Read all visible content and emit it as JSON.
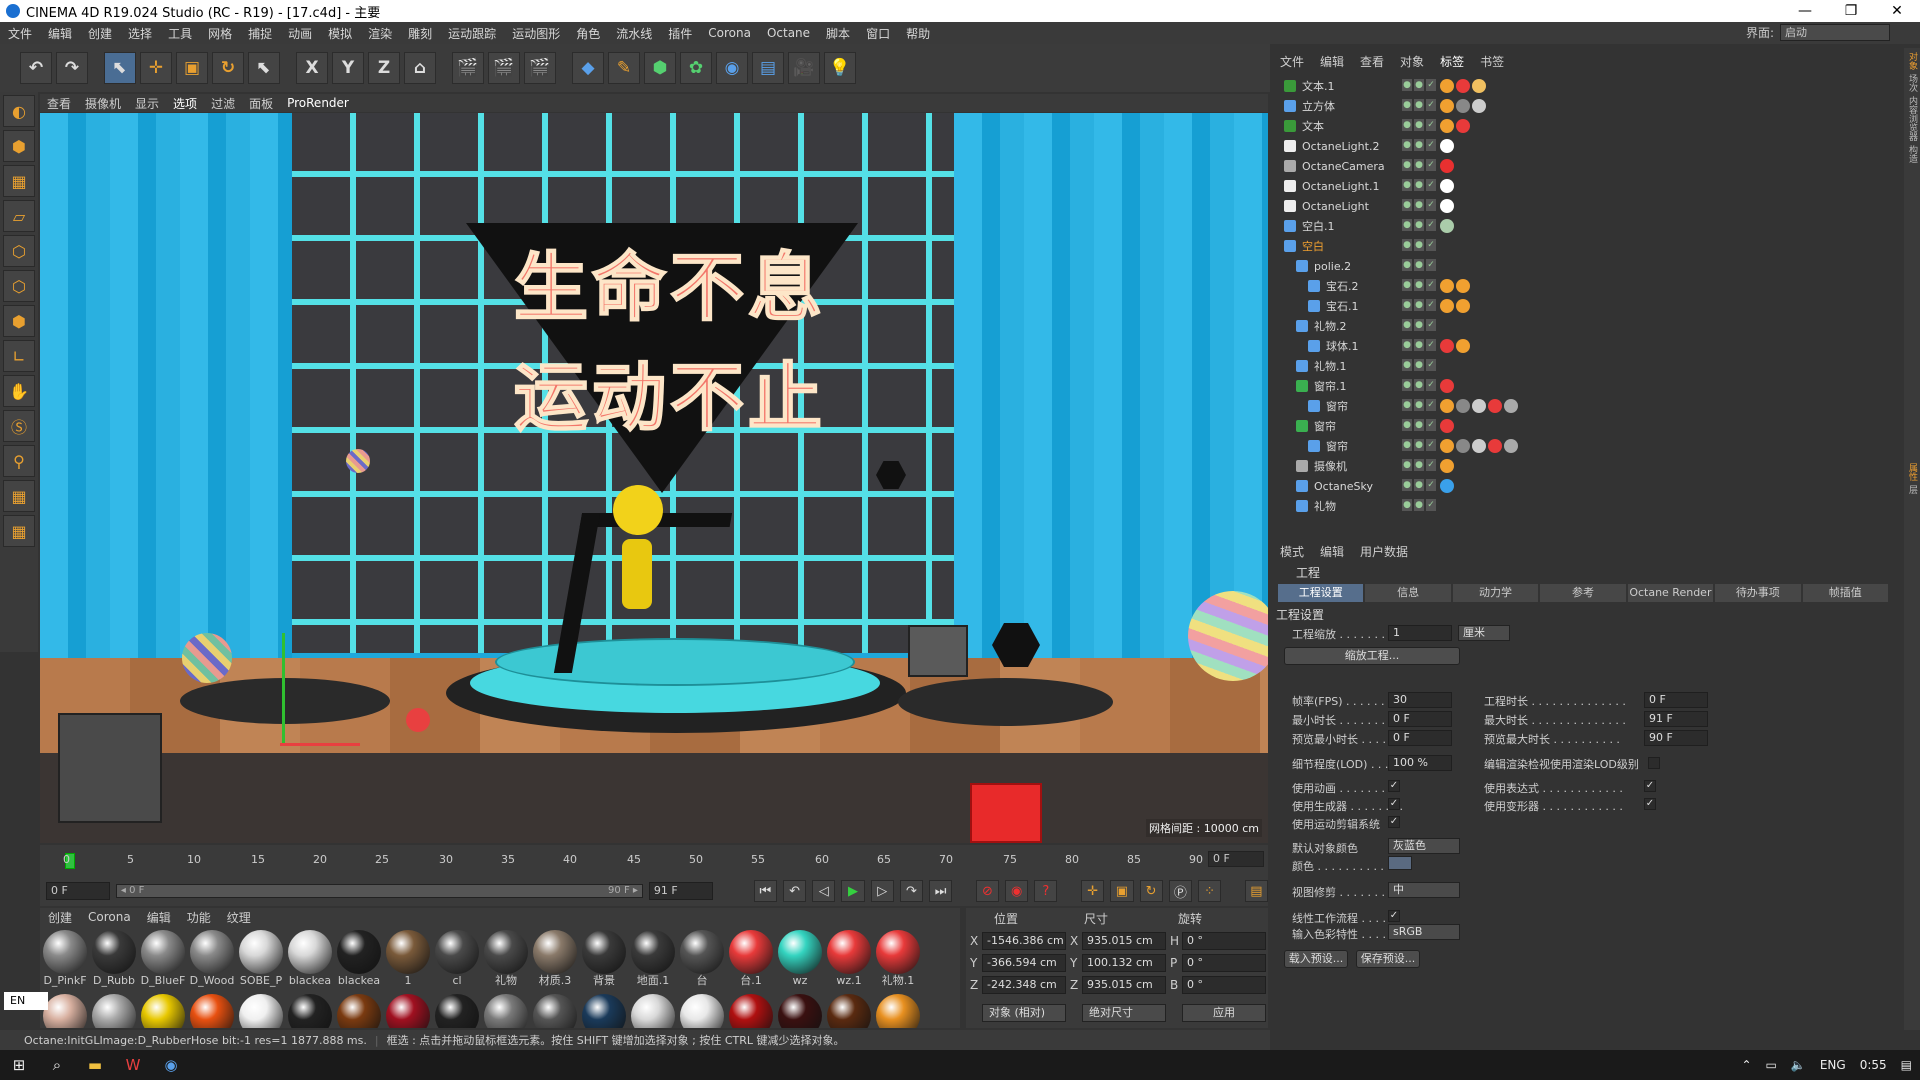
{
  "window": {
    "title": "CINEMA 4D R19.024 Studio (RC - R19) - [17.c4d] - 主要",
    "minimize": "—",
    "maximize": "❐",
    "close": "✕"
  },
  "menu": {
    "items": [
      "文件",
      "编辑",
      "创建",
      "选择",
      "工具",
      "网格",
      "捕捉",
      "动画",
      "模拟",
      "渲染",
      "雕刻",
      "运动跟踪",
      "运动图形",
      "角色",
      "流水线",
      "插件",
      "Corona",
      "Octane",
      "脚本",
      "窗口",
      "帮助"
    ],
    "layout_label": "界面:",
    "layout_value": "启动"
  },
  "toolbar": {
    "x_label": "X",
    "y_label": "Y",
    "z_label": "Z"
  },
  "viewport": {
    "menu": [
      "查看",
      "摄像机",
      "显示",
      "选项",
      "过滤",
      "面板"
    ],
    "renderer": "ProRender",
    "slogan_line1": "生命不息",
    "slogan_line2": "运动不止",
    "grid_distance": "网格间距 : 10000 cm"
  },
  "timeline": {
    "ticks": [
      "0",
      "5",
      "10",
      "15",
      "20",
      "25",
      "30",
      "35",
      "40",
      "45",
      "50",
      "55",
      "60",
      "65",
      "70",
      "75",
      "80",
      "85",
      "90"
    ],
    "end_field": "0 F",
    "start_field": "0 F",
    "slider_start": "◂ 0 F",
    "slider_end": "90 F ▸",
    "max_field": "91 F"
  },
  "materials": {
    "menu": [
      "创建",
      "Corona",
      "编辑",
      "功能",
      "纹理"
    ],
    "row1": [
      {
        "name": "D_PinkF",
        "color": "#8a8a8a"
      },
      {
        "name": "D_Rubb",
        "color": "#3a3a3a"
      },
      {
        "name": "D_BlueF",
        "color": "#8a8a8a"
      },
      {
        "name": "D_Wood",
        "color": "#8a8a8a"
      },
      {
        "name": "SOBE_P",
        "color": "#d8d8d8"
      },
      {
        "name": "blackea",
        "color": "#d8d8d8"
      },
      {
        "name": "blackea",
        "color": "#222222"
      },
      {
        "name": "1",
        "color": "#7a5a3a"
      },
      {
        "name": "cl",
        "color": "#4a4a4a"
      },
      {
        "name": "礼物",
        "color": "#4a4a4a"
      },
      {
        "name": "材质.3",
        "color": "#8a7a6a"
      },
      {
        "name": "背景",
        "color": "#3a3a3a"
      },
      {
        "name": "地面.1",
        "color": "#3a3a3a"
      },
      {
        "name": "台",
        "color": "#555555"
      },
      {
        "name": "台.1",
        "color": "#e83a3a"
      },
      {
        "name": "wz",
        "color": "#34d4c0"
      },
      {
        "name": "wz.1",
        "color": "#e83a3a"
      },
      {
        "name": "礼物.1",
        "color": "#e83a3a"
      }
    ],
    "row2_colors": [
      "#d8b0a0",
      "#aaaaaa",
      "#e8c800",
      "#e85010",
      "#f0f0f0",
      "#222222",
      "#7a3a10",
      "#a01020",
      "#222222",
      "#7a7a7a",
      "#555555",
      "#1a3a5a",
      "#d8d8d8",
      "#e8e8e8",
      "#b01010",
      "#3a1010",
      "#5a2a10",
      "#e89020"
    ]
  },
  "coords": {
    "headers": {
      "position": "位置",
      "size": "尺寸",
      "rotation": "旋转"
    },
    "px": "-1546.386 cm",
    "py": "-366.594 cm",
    "pz": "-242.348 cm",
    "sx": "935.015 cm",
    "sy": "100.132 cm",
    "sz": "935.015 cm",
    "rh": "0 °",
    "rp": "0 °",
    "rb": "0 °",
    "axis_x": "X",
    "axis_y": "Y",
    "axis_z": "Z",
    "rot_h": "H",
    "rot_p": "P",
    "rot_b": "B",
    "mode_object": "对象 (相对)",
    "mode_size": "绝对尺寸",
    "apply": "应用"
  },
  "status": {
    "left": "Octane:InitGLImage:D_RubberHose  bit:-1 res=1  1877.888 ms.",
    "hint": "框选 : 点击并拖动鼠标框选元素。按住 SHIFT 键增加选择对象 ; 按住 CTRL 键减少选择对象。"
  },
  "taskbar": {
    "lang": "ENG",
    "time": "0:55",
    "ime": "EN"
  },
  "objects": {
    "menu": [
      "文件",
      "编辑",
      "查看",
      "对象",
      "标签",
      "书签"
    ],
    "rows": [
      {
        "name": "文本.1",
        "indent": 0,
        "icon": "#3a9a3a",
        "tags": [
          "#f0a030",
          "#e83a3a",
          "#f0c060"
        ]
      },
      {
        "name": "立方体",
        "indent": 0,
        "icon": "#5aa0ea",
        "tags": [
          "#f0a030",
          "#888888",
          "#cccccc"
        ]
      },
      {
        "name": "文本",
        "indent": 0,
        "icon": "#3a9a3a",
        "tags": [
          "#f0a030",
          "#e83a3a"
        ]
      },
      {
        "name": "OctaneLight.2",
        "indent": 0,
        "icon": "#eeeeee",
        "tags": [
          "#ffffff"
        ]
      },
      {
        "name": "OctaneCamera",
        "indent": 0,
        "icon": "#aaaaaa",
        "tags": [
          "#e83030"
        ]
      },
      {
        "name": "OctaneLight.1",
        "indent": 0,
        "icon": "#eeeeee",
        "tags": [
          "#ffffff"
        ]
      },
      {
        "name": "OctaneLight",
        "indent": 0,
        "icon": "#eeeeee",
        "tags": [
          "#ffffff"
        ]
      },
      {
        "name": "空白.1",
        "indent": 0,
        "icon": "#5aa0ea",
        "tags": [
          "#aaccaa"
        ]
      },
      {
        "name": "空白",
        "indent": 0,
        "icon": "#5aa0ea",
        "tags": [],
        "selected": true
      },
      {
        "name": "polie.2",
        "indent": 1,
        "icon": "#5aa0ea",
        "tags": []
      },
      {
        "name": "宝石.2",
        "indent": 2,
        "icon": "#5aa0ea",
        "tags": [
          "#f0a030",
          "#f0a030"
        ]
      },
      {
        "name": "宝石.1",
        "indent": 2,
        "icon": "#5aa0ea",
        "tags": [
          "#f0a030",
          "#f0a030"
        ]
      },
      {
        "name": "礼物.2",
        "indent": 1,
        "icon": "#5aa0ea",
        "tags": []
      },
      {
        "name": "球体.1",
        "indent": 2,
        "icon": "#5aa0ea",
        "tags": [
          "#e83a3a",
          "#f0a030"
        ]
      },
      {
        "name": "礼物.1",
        "indent": 1,
        "icon": "#5aa0ea",
        "tags": []
      },
      {
        "name": "窗帘.1",
        "indent": 1,
        "icon": "#3ab050",
        "tags": [
          "#e83a3a"
        ]
      },
      {
        "name": "窗帘",
        "indent": 2,
        "icon": "#5aa0ea",
        "tags": [
          "#f0a030",
          "#888888",
          "#cccccc",
          "#e83a3a",
          "#aaaaaa"
        ]
      },
      {
        "name": "窗帘",
        "indent": 1,
        "icon": "#3ab050",
        "tags": [
          "#e83a3a"
        ]
      },
      {
        "name": "窗帘",
        "indent": 2,
        "icon": "#5aa0ea",
        "tags": [
          "#f0a030",
          "#888888",
          "#cccccc",
          "#e83a3a",
          "#aaaaaa"
        ]
      },
      {
        "name": "摄像机",
        "indent": 1,
        "icon": "#aaaaaa",
        "tags": [
          "#f0a030"
        ]
      },
      {
        "name": "OctaneSky",
        "indent": 1,
        "icon": "#5aa0ea",
        "tags": [
          "#3aa0ea"
        ]
      },
      {
        "name": "礼物",
        "indent": 1,
        "icon": "#5aa0ea",
        "tags": []
      }
    ]
  },
  "attributes": {
    "menu": [
      "模式",
      "编辑",
      "用户数据"
    ],
    "title": "工程",
    "tabs": [
      "工程设置",
      "信息",
      "动力学",
      "参考",
      "Octane Render",
      "待办事项",
      "帧插值"
    ],
    "section": "工程设置",
    "project_scale_label": "工程缩放 . . . . . . . . .",
    "project_scale_value": "1",
    "project_scale_unit": "厘米",
    "scale_project_button": "缩放工程...",
    "fps_label": "帧率(FPS) . . . . . . . . .",
    "fps_value": "30",
    "project_time_label": "工程时长 . . . . . . . . . . . . . .",
    "project_time_value": "0 F",
    "min_time_label": "最小时长 . . . . . . . . . .",
    "min_time_value": "0 F",
    "max_time_label": "最大时长 . . . . . . . . . . . . . .",
    "max_time_value": "91 F",
    "preview_min_label": "预览最小时长 . . . . . .",
    "preview_min_value": "0 F",
    "preview_max_label": "预览最大时长 . . . . . . . . . .",
    "preview_max_value": "90 F",
    "lod_label": "细节程度(LOD) . . . . .",
    "lod_value": "100 %",
    "render_lod_label": "编辑渲染检视使用渲染LOD级别",
    "use_anim_label": "使用动画 . . . . . . . . .",
    "use_expr_label": "使用表达式 . . . . . . . . . . . .",
    "use_gen_label": "使用生成器 . . . . . . . .",
    "use_deform_label": "使用变形器 . . . . . . . . . . . .",
    "use_mograph_label": "使用运动剪辑系统",
    "default_color_label": "默认对象颜色",
    "default_color_value": "灰蓝色",
    "color_label": "颜色 . . . . . . . . . . . .",
    "clipping_label": "视图修剪 . . . . . . . . .",
    "clipping_value": "中",
    "linear_label": "线性工作流程 . . . . .",
    "input_color_label": "输入色彩特性 . . . . .",
    "input_color_value": "sRGB",
    "load_preset": "载入预设...",
    "save_preset": "保存预设..."
  },
  "right_strip": [
    "对象",
    "场次",
    "内容浏览器",
    "构造",
    "属性",
    "层"
  ]
}
